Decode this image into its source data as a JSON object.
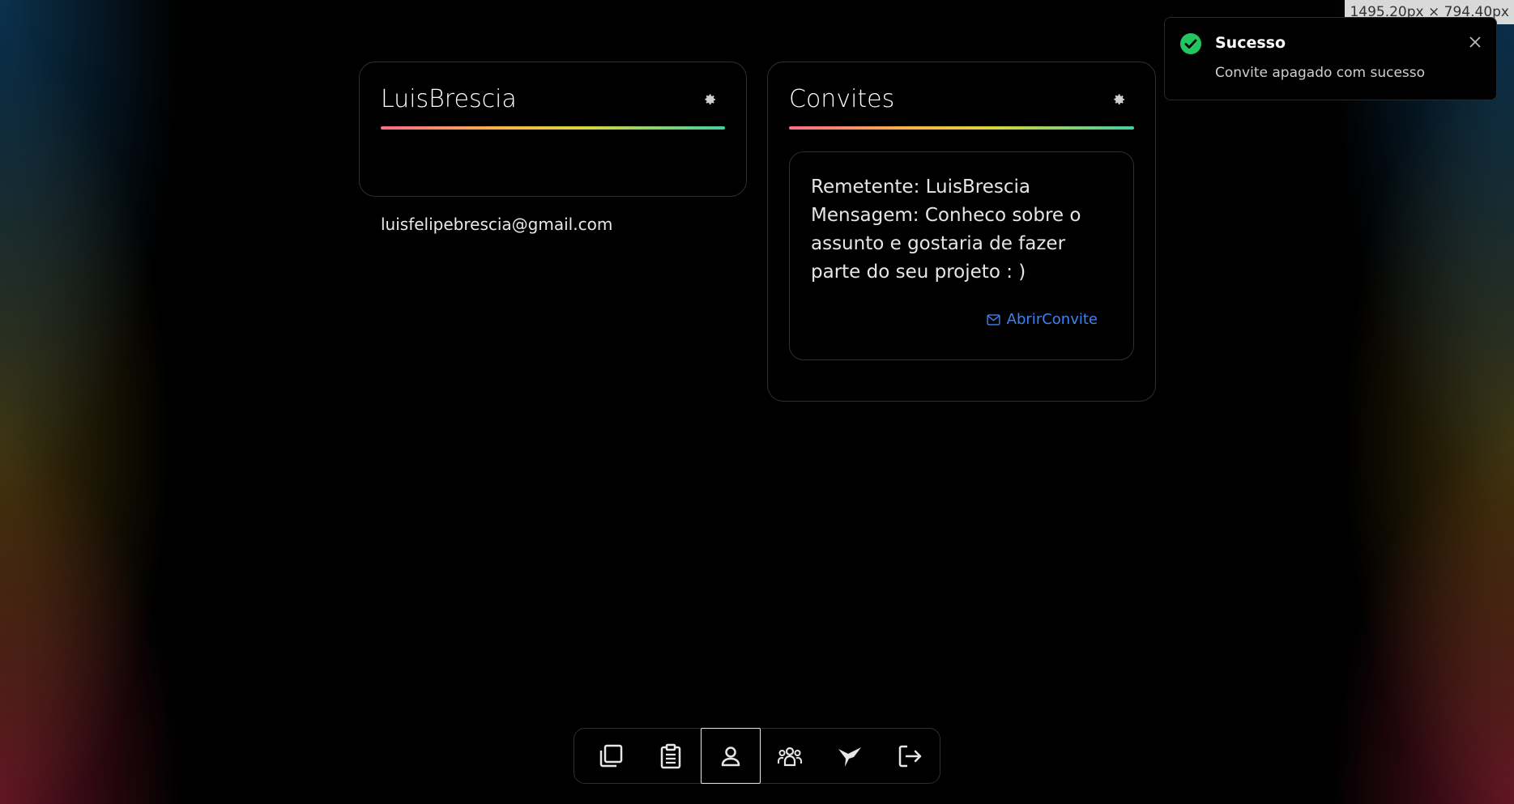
{
  "viewport_badge": "1495.20px × 794.40px",
  "profile_card": {
    "title": "LuisBrescia",
    "email": "luisfelipebrescia@gmail.com",
    "settings_icon": "gear-icon"
  },
  "invites_card": {
    "title": "Convites",
    "settings_icon": "gear-icon",
    "invites": [
      {
        "sender_line": "Remetente: LuisBrescia",
        "message_line": "Mensagem: Conheco sobre o assunto e gostaria de fazer parte do seu projeto : )",
        "open_label": "AbrirConvite",
        "open_icon": "mail-icon"
      }
    ]
  },
  "toast": {
    "title": "Sucesso",
    "message": "Convite apagado com sucesso",
    "icon": "check-circle-icon",
    "success_color": "#22c55e"
  },
  "dock": {
    "items": [
      {
        "name": "projects",
        "icon": "layers-icon",
        "active": false
      },
      {
        "name": "tasks",
        "icon": "clipboard-icon",
        "active": false
      },
      {
        "name": "profile",
        "icon": "user-icon",
        "active": true
      },
      {
        "name": "teams",
        "icon": "users-group-icon",
        "active": false
      },
      {
        "name": "hummingbird",
        "icon": "bird-icon",
        "active": false
      },
      {
        "name": "logout",
        "icon": "logout-icon",
        "active": false
      }
    ]
  },
  "colors": {
    "accent_link": "#3b82f6",
    "border": "#2e2e2e",
    "background": "#000000"
  }
}
